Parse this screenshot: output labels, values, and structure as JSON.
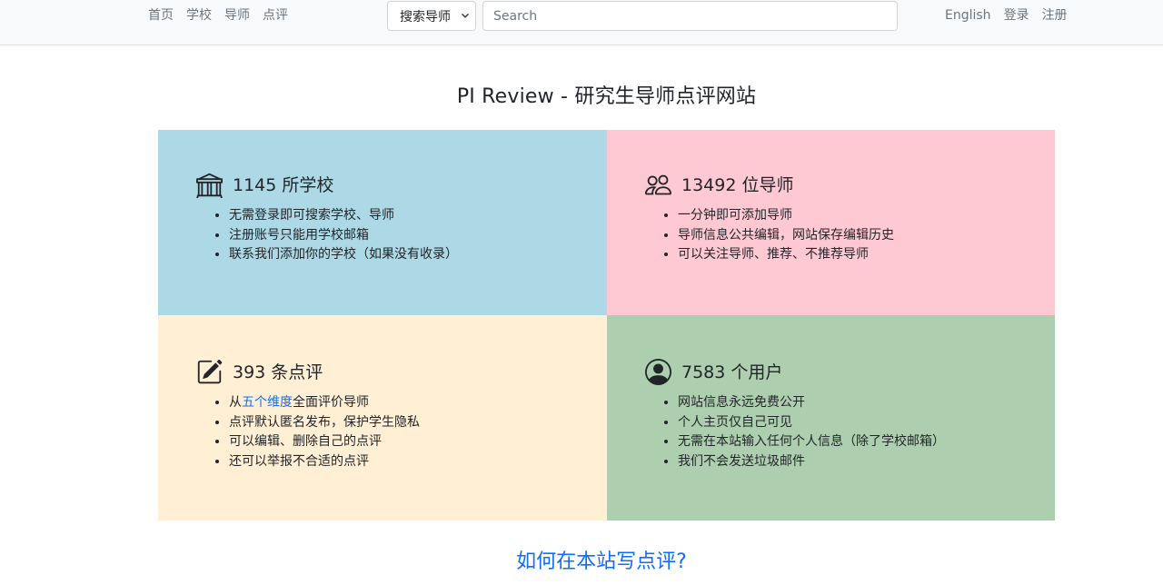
{
  "navbar": {
    "left_links": [
      "首页",
      "学校",
      "导师",
      "点评"
    ],
    "search_select": {
      "selected": "搜索导师",
      "icon": "chevron-down-icon"
    },
    "search_input": {
      "value": "",
      "placeholder": "Search"
    },
    "right_links": [
      "English",
      "登录",
      "注册"
    ]
  },
  "page": {
    "title": "PI Review - 研究生导师点评网站"
  },
  "colors": {
    "schools_bg": "#add8e6",
    "advisors_bg": "#ffc9d3",
    "reviews_bg": "#ffefd5",
    "users_bg": "#aecfaf",
    "link": "#0d6efd"
  },
  "quadrants": {
    "schools": {
      "icon": "bank-icon",
      "title": "1145 所学校",
      "items": [
        "无需登录即可搜索学校、导师",
        "注册账号只能用学校邮箱",
        "联系我们添加你的学校（如果没有收录）"
      ]
    },
    "advisors": {
      "icon": "people-icon",
      "title": "13492 位导师",
      "items": [
        "一分钟即可添加导师",
        "导师信息公共编辑，网站保存编辑历史",
        "可以关注导师、推荐、不推荐导师"
      ]
    },
    "reviews": {
      "icon": "pencil-square-icon",
      "title": "393 条点评",
      "first_item": {
        "prefix": "从",
        "link": "五个维度",
        "suffix": "全面评价导师"
      },
      "items": [
        "点评默认匿名发布，保护学生隐私",
        "可以编辑、删除自己的点评",
        "还可以举报不合适的点评"
      ]
    },
    "users": {
      "icon": "person-circle-icon",
      "title": "7583 个用户",
      "items": [
        "网站信息永远免费公开",
        "个人主页仅自己可见",
        "无需在本站输入任何个人信息（除了学校邮箱）",
        "我们不会发送垃圾邮件"
      ]
    }
  },
  "footer": {
    "howto_link": "如何在本站写点评?"
  }
}
